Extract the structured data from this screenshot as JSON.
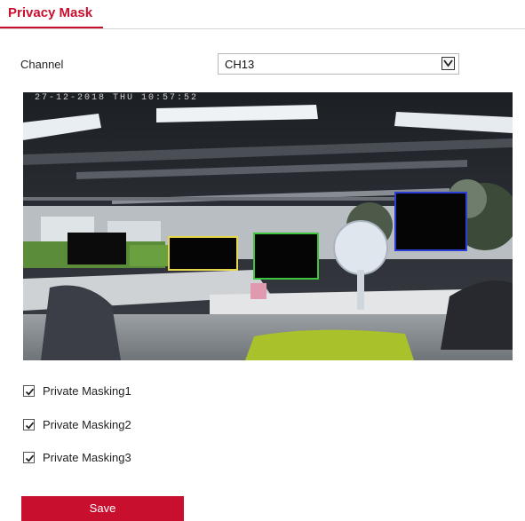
{
  "page": {
    "title": "Privacy Mask"
  },
  "channel": {
    "label": "Channel",
    "value": "CH13"
  },
  "video": {
    "timestamp": "27-12-2018 THU 10:57:52"
  },
  "masks": [
    {
      "label": "Private Masking1",
      "checked": true,
      "color": "#e6d84a"
    },
    {
      "label": "Private Masking2",
      "checked": true,
      "color": "#3fc43f"
    },
    {
      "label": "Private Masking3",
      "checked": true,
      "color": "#2b3ed6"
    }
  ],
  "actions": {
    "save_label": "Save"
  },
  "colors": {
    "accent": "#c8102e"
  }
}
